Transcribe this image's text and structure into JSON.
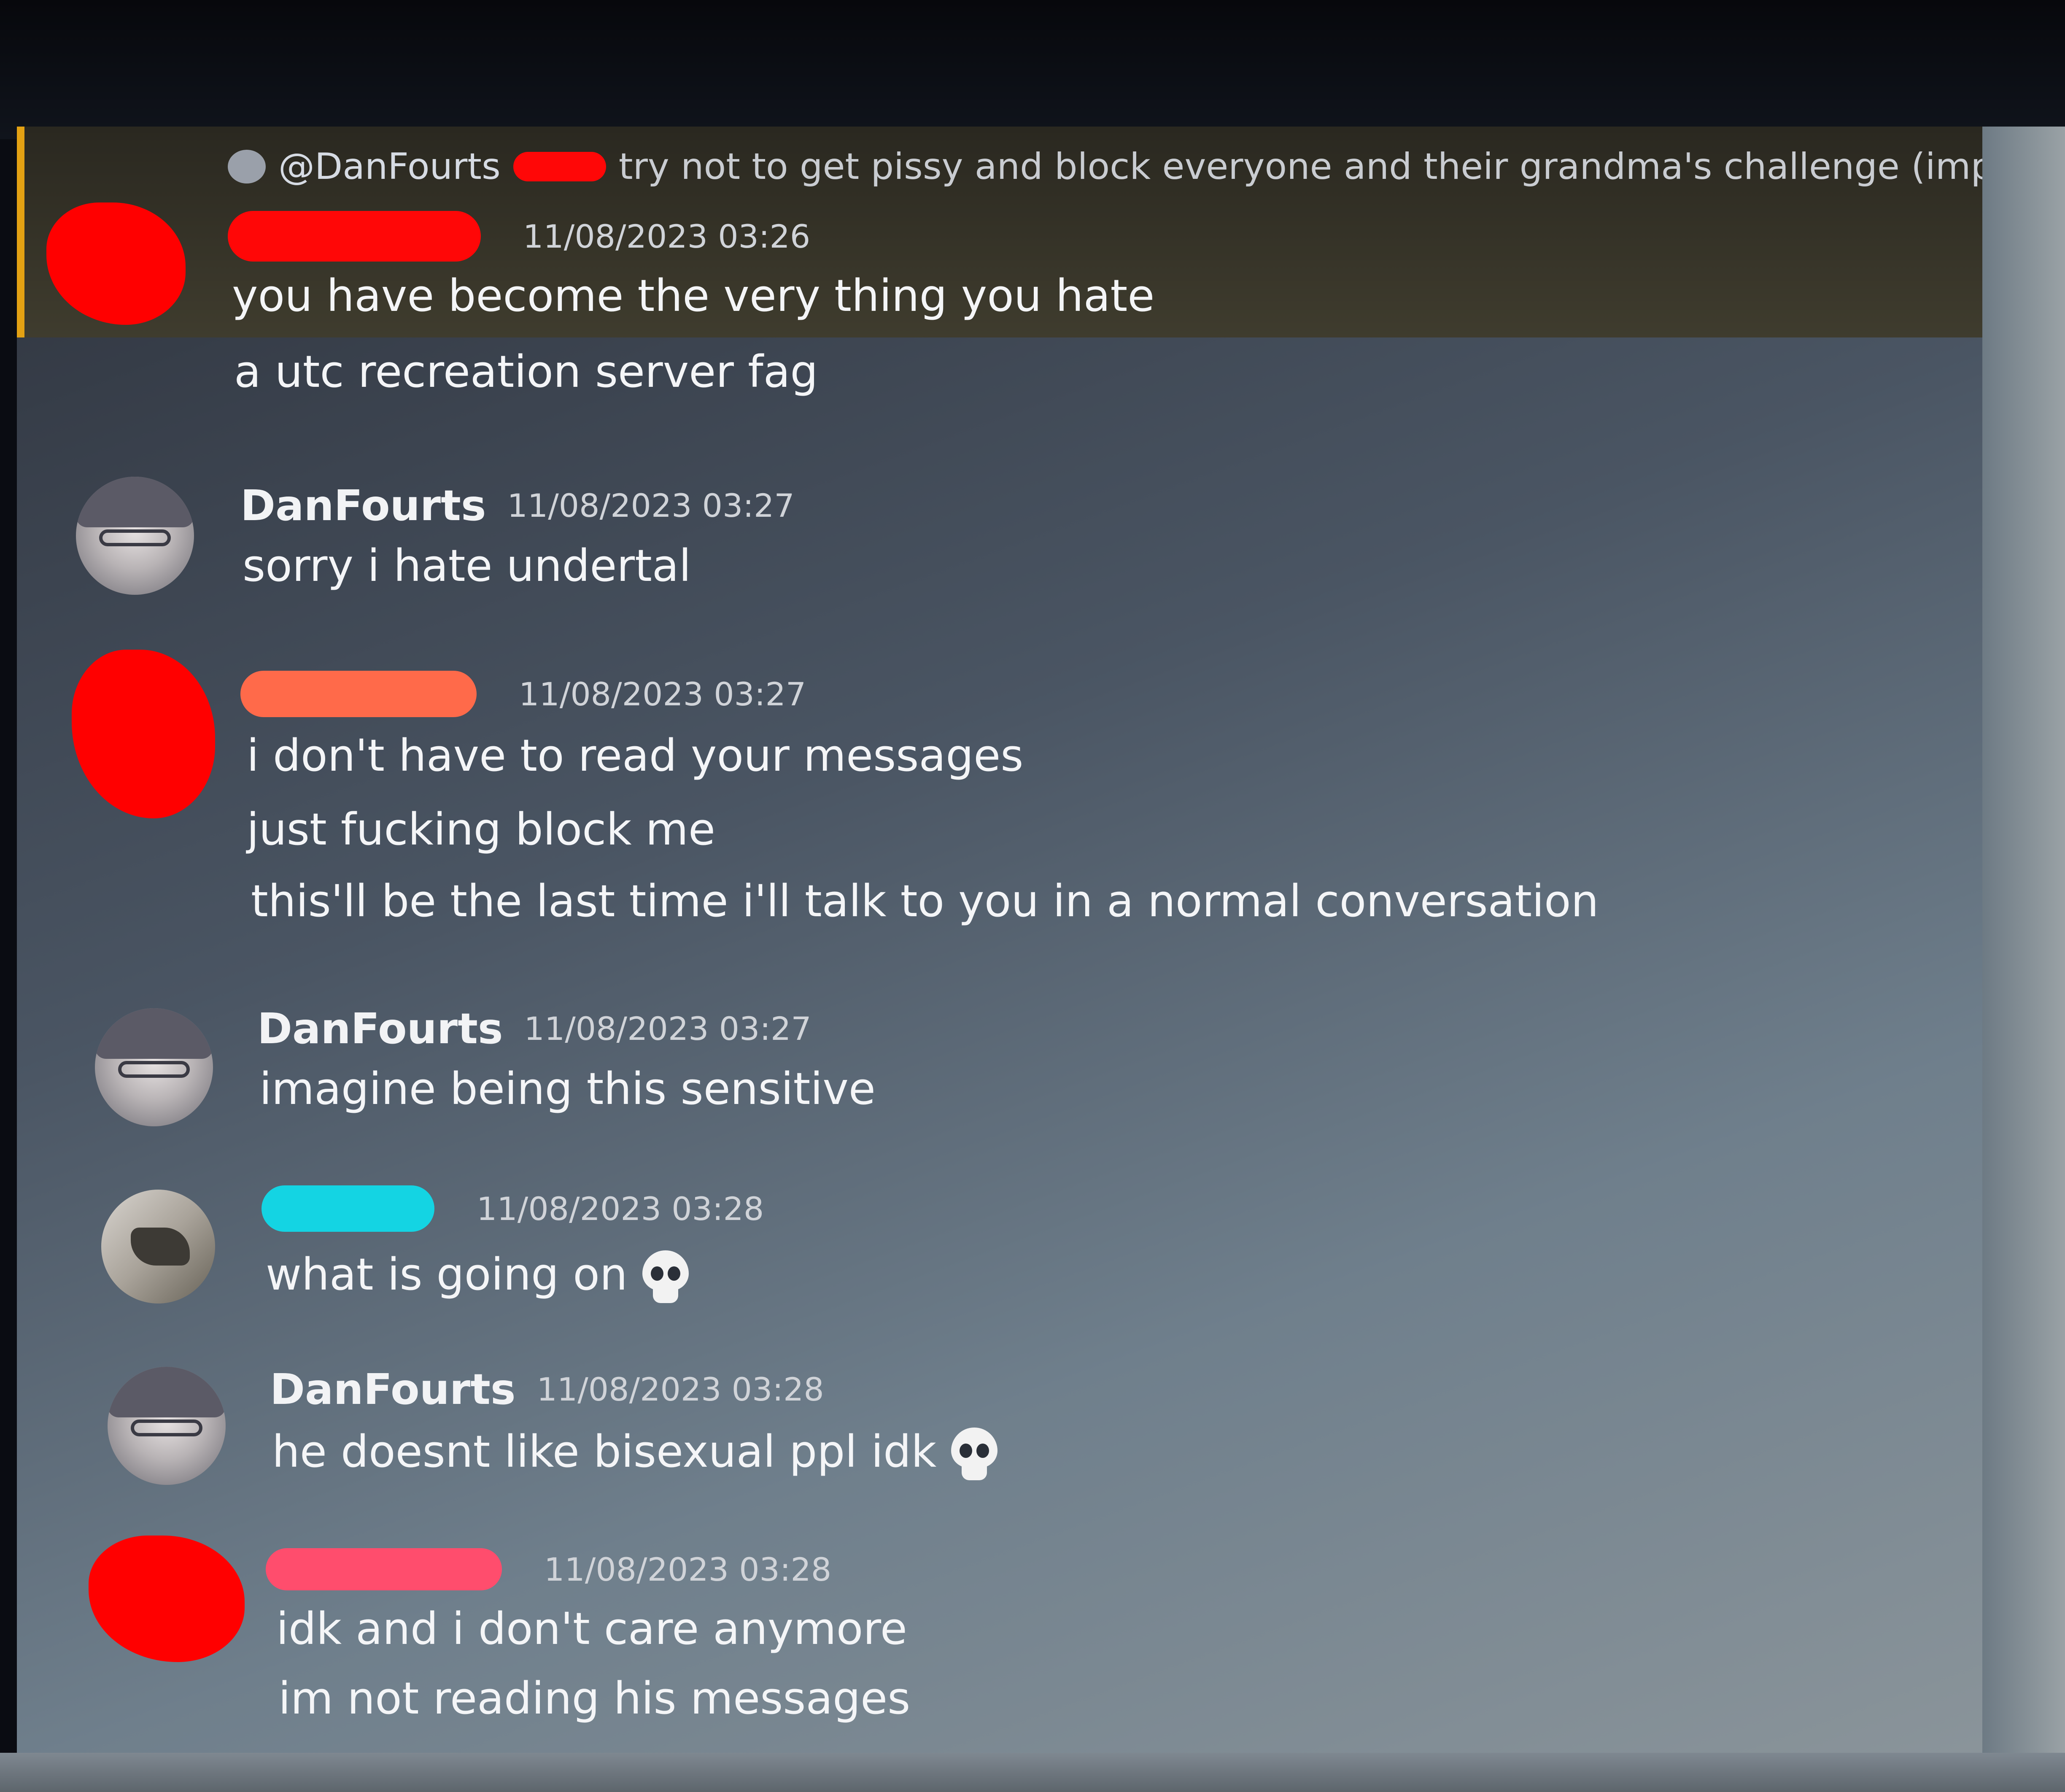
{
  "reply": {
    "mention": "@DanFourts",
    "text": "try not to get pissy and block everyone and their grandma's challenge (impossible)"
  },
  "messages": [
    {
      "username": "",
      "timestamp": "11/08/2023 03:26",
      "lines": [
        "you have become the very thing you hate",
        "a utc recreation server fag"
      ]
    },
    {
      "username": "DanFourts",
      "timestamp": "11/08/2023 03:27",
      "lines": [
        "sorry i hate undertal"
      ]
    },
    {
      "username": "",
      "timestamp": "11/08/2023 03:27",
      "lines": [
        "i don't have to read your messages",
        "just fucking block me",
        "this'll be the last time i'll talk to you in a normal conversation"
      ]
    },
    {
      "username": "DanFourts",
      "timestamp": "11/08/2023 03:27",
      "lines": [
        "imagine being this sensitive"
      ]
    },
    {
      "username": "",
      "timestamp": "11/08/2023 03:28",
      "lines": [
        "what is going on"
      ]
    },
    {
      "username": "DanFourts",
      "timestamp": "11/08/2023 03:28",
      "lines": [
        "he doesnt like bisexual ppl idk"
      ]
    },
    {
      "username": "",
      "timestamp": "11/08/2023 03:28",
      "lines": [
        "idk and i don't care anymore",
        "im not reading his messages"
      ]
    }
  ],
  "colors": {
    "highlight_bar": "#e3a113",
    "redaction_red": "#ff0707",
    "redaction_orange": "#ff6a4a",
    "redaction_cyan": "#14d4e3",
    "redaction_pink": "#ff4d6d"
  },
  "icons": {
    "skull": "skull-emoji",
    "reply": "reply-avatar-icon"
  }
}
